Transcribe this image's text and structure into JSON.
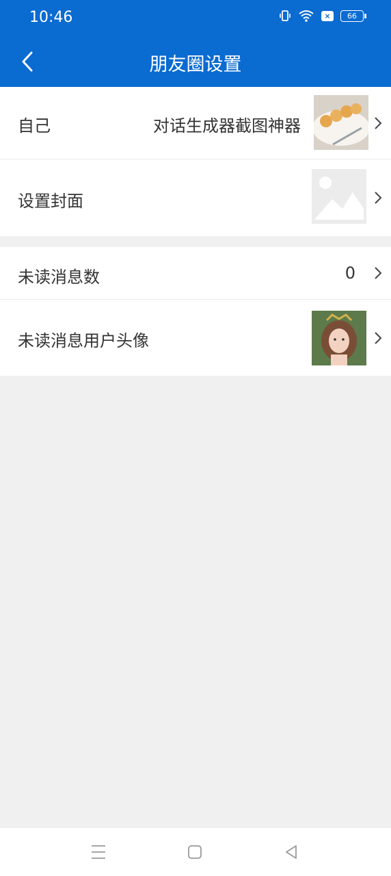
{
  "status": {
    "time": "10:46",
    "battery": "66",
    "x_badge": "×"
  },
  "header": {
    "title": "朋友圈设置",
    "back_icon": "chevron-left-icon"
  },
  "rows": {
    "self": {
      "label": "自己",
      "value": "对话生成器截图神器"
    },
    "cover": {
      "label": "设置封面"
    },
    "unread_count": {
      "label": "未读消息数",
      "value": "0"
    },
    "unread_avatar": {
      "label": "未读消息用户头像"
    }
  },
  "colors": {
    "appbar": "#0a6bd1",
    "background": "#f0f0f0"
  }
}
